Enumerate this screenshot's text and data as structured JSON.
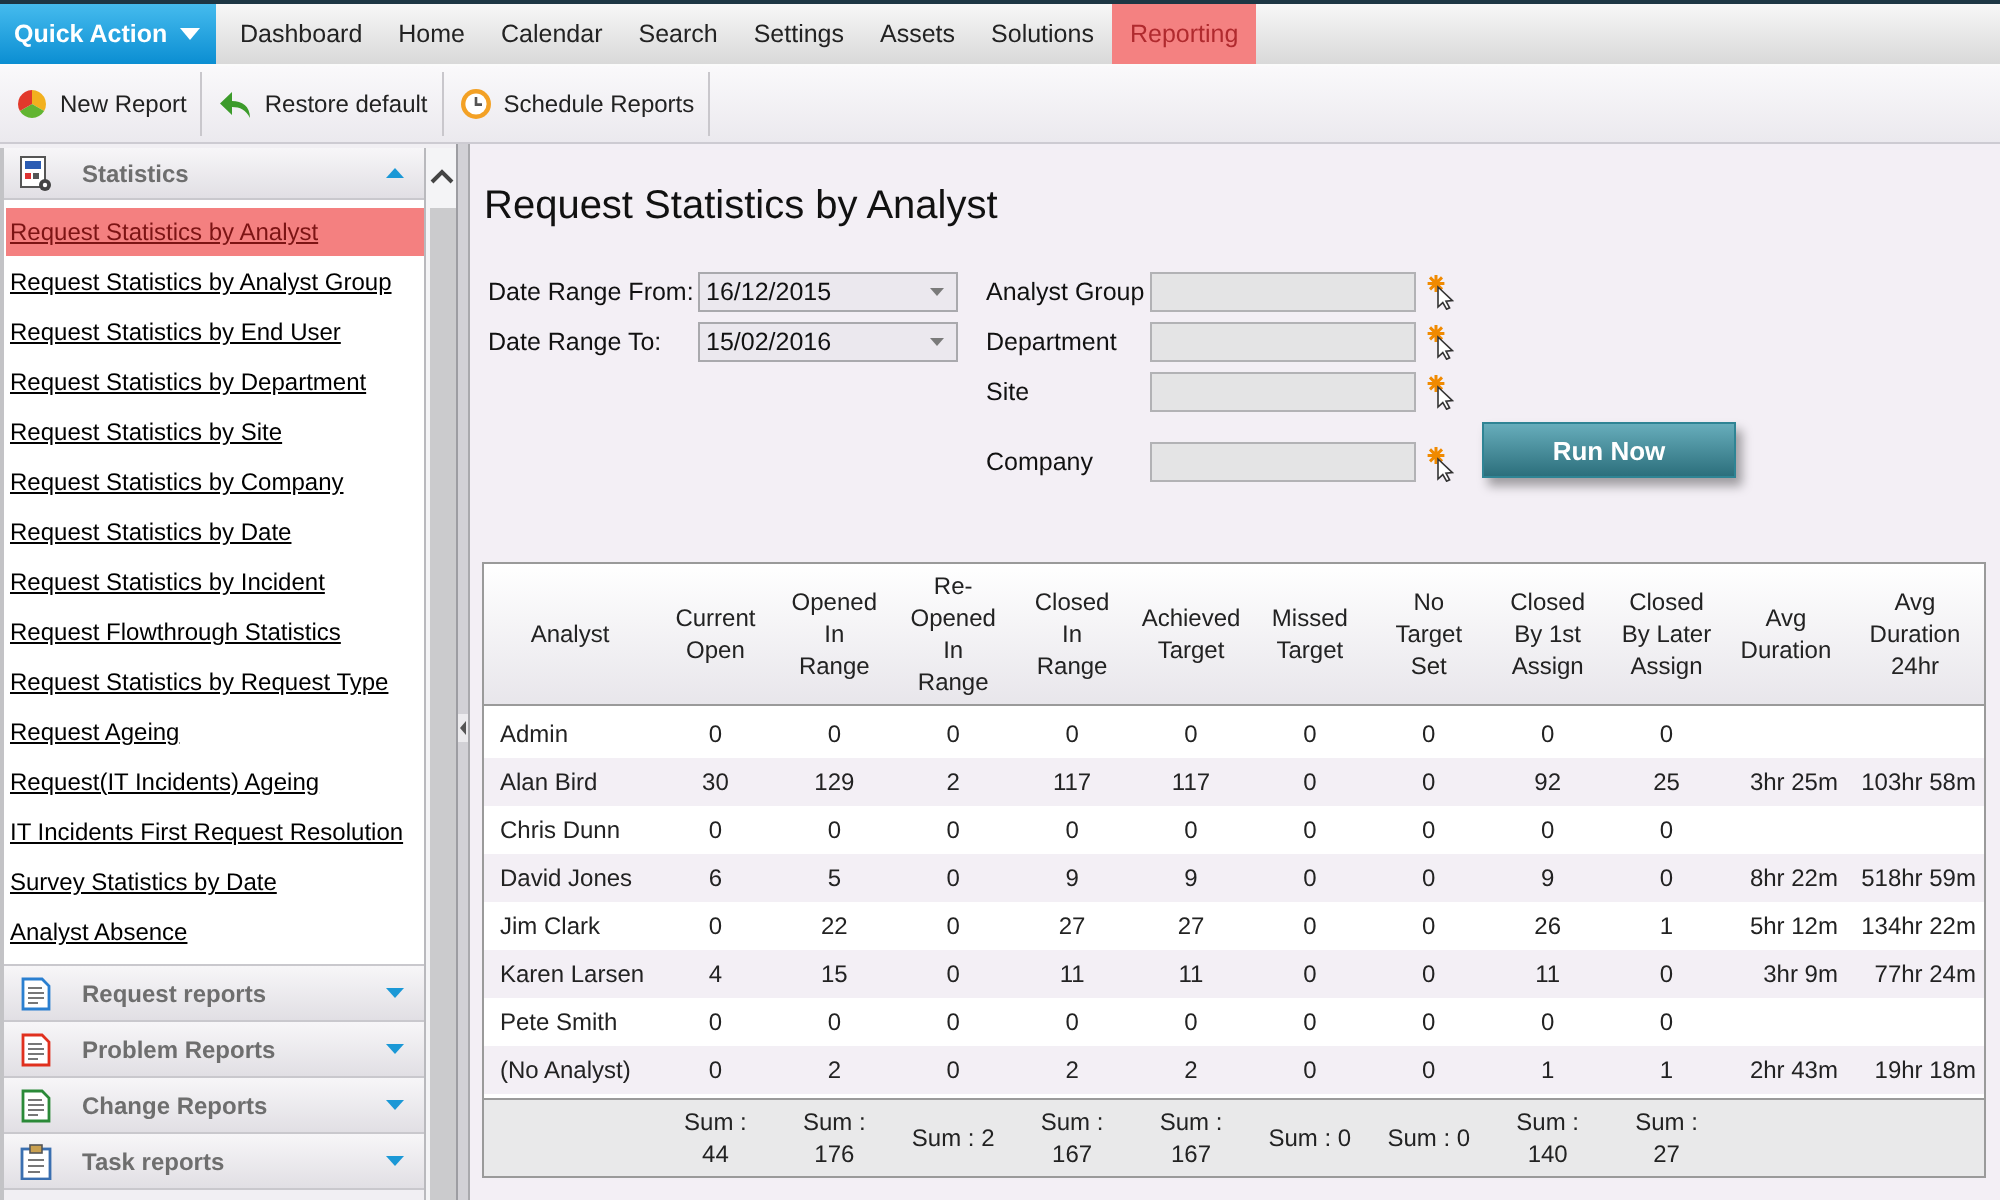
{
  "top_nav": {
    "quick_action": "Quick Action",
    "tabs": [
      {
        "label": "Dashboard",
        "selected": false
      },
      {
        "label": "Home",
        "selected": false
      },
      {
        "label": "Calendar",
        "selected": false
      },
      {
        "label": "Search",
        "selected": false
      },
      {
        "label": "Settings",
        "selected": false
      },
      {
        "label": "Assets",
        "selected": false
      },
      {
        "label": "Solutions",
        "selected": false
      },
      {
        "label": "Reporting",
        "selected": true
      }
    ]
  },
  "toolbar": [
    {
      "label": "New Report",
      "kind": "new"
    },
    {
      "label": "Restore default",
      "kind": "restore"
    },
    {
      "label": "Schedule Reports",
      "kind": "schedule"
    }
  ],
  "sidebar": {
    "sections": [
      {
        "title": "Statistics",
        "kind": "statistics",
        "expanded": true,
        "items": [
          {
            "label": "Request Statistics by Analyst",
            "selected": true
          },
          {
            "label": "Request Statistics by Analyst Group",
            "selected": false
          },
          {
            "label": "Request Statistics by End User",
            "selected": false
          },
          {
            "label": "Request Statistics by Department",
            "selected": false
          },
          {
            "label": "Request Statistics by Site",
            "selected": false
          },
          {
            "label": "Request Statistics by Company",
            "selected": false
          },
          {
            "label": "Request Statistics by Date",
            "selected": false
          },
          {
            "label": "Request Statistics by Incident",
            "selected": false
          },
          {
            "label": "Request Flowthrough Statistics",
            "selected": false
          },
          {
            "label": "Request Statistics by Request Type",
            "selected": false
          },
          {
            "label": "Request Ageing",
            "selected": false
          },
          {
            "label": "Request(IT Incidents) Ageing",
            "selected": false
          },
          {
            "label": "IT Incidents First Request Resolution",
            "selected": false
          },
          {
            "label": "Survey Statistics by Date",
            "selected": false
          },
          {
            "label": "Analyst Absence",
            "selected": false
          }
        ]
      },
      {
        "title": "Request reports",
        "kind": "request",
        "expanded": false
      },
      {
        "title": "Problem Reports",
        "kind": "problem",
        "expanded": false
      },
      {
        "title": "Change Reports",
        "kind": "change",
        "expanded": false
      },
      {
        "title": "Task reports",
        "kind": "task",
        "expanded": false
      }
    ]
  },
  "report": {
    "title": "Request Statistics by Analyst",
    "date_range": [
      {
        "label": "Date Range From:",
        "value": "16/12/2015"
      },
      {
        "label": "Date Range To:",
        "value": "15/02/2016"
      }
    ],
    "filters": [
      {
        "label": "Analyst Group"
      },
      {
        "label": "Department"
      },
      {
        "label": "Site"
      },
      {
        "label": "Company"
      }
    ],
    "run_button": "Run Now",
    "table": {
      "columns": [
        "Analyst",
        "Current Open",
        "Opened In Range",
        "Re-Opened In Range",
        "Closed In Range",
        "Achieved Target",
        "Missed Target",
        "No Target Set",
        "Closed By 1st Assign",
        "Closed By Later Assign",
        "Avg Duration",
        "Avg Duration 24hr"
      ],
      "rows": [
        {
          "analyst": "Admin",
          "counts": [
            "0",
            "0",
            "0",
            "0",
            "0",
            "0",
            "0",
            "0",
            "0"
          ]
        },
        {
          "analyst": "Alan Bird",
          "counts": [
            "30",
            "129",
            "2",
            "117",
            "117",
            "0",
            "0",
            "92",
            "25"
          ],
          "avg_duration": "3hr 25m",
          "avg_duration_24hr": "103hr 58m"
        },
        {
          "analyst": "Chris Dunn",
          "counts": [
            "0",
            "0",
            "0",
            "0",
            "0",
            "0",
            "0",
            "0",
            "0"
          ]
        },
        {
          "analyst": "David Jones",
          "counts": [
            "6",
            "5",
            "0",
            "9",
            "9",
            "0",
            "0",
            "9",
            "0"
          ],
          "avg_duration": "8hr 22m",
          "avg_duration_24hr": "518hr 59m"
        },
        {
          "analyst": "Jim Clark",
          "counts": [
            "0",
            "22",
            "0",
            "27",
            "27",
            "0",
            "0",
            "26",
            "1"
          ],
          "avg_duration": "5hr 12m",
          "avg_duration_24hr": "134hr 22m"
        },
        {
          "analyst": "Karen Larsen",
          "counts": [
            "4",
            "15",
            "0",
            "11",
            "11",
            "0",
            "0",
            "11",
            "0"
          ],
          "avg_duration": "3hr 9m",
          "avg_duration_24hr": "77hr 24m"
        },
        {
          "analyst": "Pete Smith",
          "counts": [
            "0",
            "0",
            "0",
            "0",
            "0",
            "0",
            "0",
            "0",
            "0"
          ]
        },
        {
          "analyst": "(No Analyst)",
          "counts": [
            "0",
            "2",
            "0",
            "2",
            "2",
            "0",
            "0",
            "1",
            "1"
          ],
          "avg_duration": "2hr 43m",
          "avg_duration_24hr": "19hr 18m"
        }
      ],
      "sums": [
        "Sum : 44",
        "Sum : 176",
        "Sum : 2",
        "Sum : 167",
        "Sum : 167",
        "Sum : 0",
        "Sum : 0",
        "Sum : 140",
        "Sum : 27"
      ]
    }
  }
}
